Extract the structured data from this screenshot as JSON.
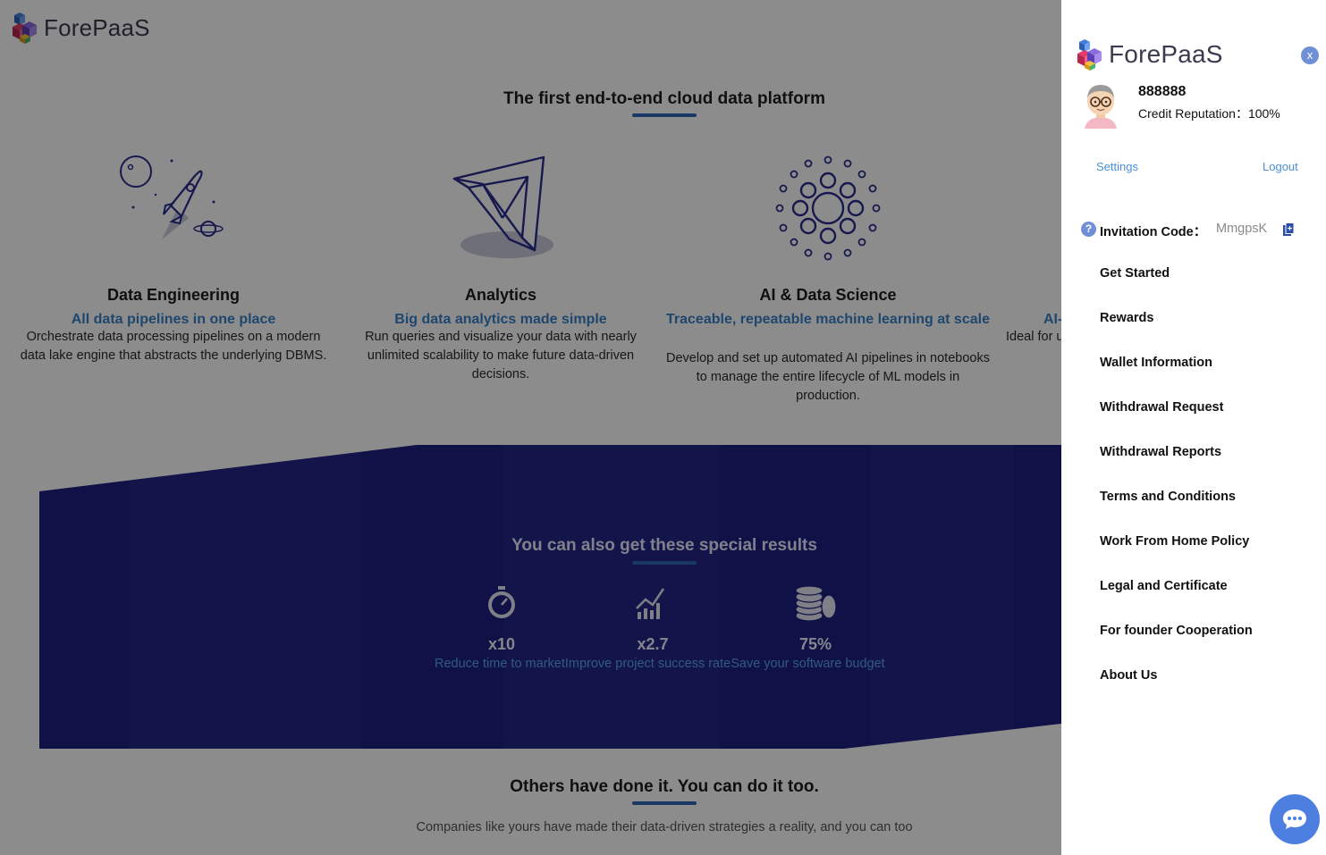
{
  "brand": {
    "name": "ForePaaS"
  },
  "hero": {
    "title": "The first end-to-end cloud data platform"
  },
  "features": [
    {
      "name": "Data Engineering",
      "tagline": "All data pipelines in one place",
      "description": "Orchestrate data processing pipelines on a modern data lake engine that abstracts the underlying DBMS."
    },
    {
      "name": "Analytics",
      "tagline": "Big data analytics made simple",
      "description": "Run queries and visualize your data with nearly unlimited scalability to make future data-driven decisions."
    },
    {
      "name": "AI & Data Science",
      "tagline": "Traceable, repeatable machine learning at scale",
      "description": "Develop and set up automated AI pipelines in notebooks to manage the entire lifecycle of ML models in production."
    },
    {
      "name": "",
      "tagline": "AI-",
      "description": "Ideal for u"
    }
  ],
  "results": {
    "title": "You can also get these special results",
    "stats": [
      {
        "value": "x10",
        "icon": "stopwatch-icon"
      },
      {
        "value": "x2.7",
        "icon": "growth-chart-icon"
      },
      {
        "value": "75%",
        "icon": "coins-icon"
      }
    ],
    "captions": "Reduce time to marketImprove project success rateSave your software budget"
  },
  "others": {
    "title": "Others have done it. You can do it too.",
    "subtitle": "Companies like yours have made their data-driven strategies a reality, and you can too"
  },
  "drawer": {
    "close_label": "x",
    "username": "888888",
    "credit": "Credit Reputation：100%",
    "settings": "Settings",
    "logout": "Logout",
    "invitation_label": "Invitation Code：",
    "invitation_code": "MmgpsK",
    "menu": [
      "Get Started",
      "Rewards",
      "Wallet Information",
      "Withdrawal Request",
      "Withdrawal Reports",
      "Terms and Conditions",
      "Work From Home Policy",
      "Legal and Certificate",
      "For founder Cooperation",
      "About Us"
    ]
  },
  "colors": {
    "accent": "#2e66b8",
    "band": "#1d1f82",
    "link": "#4a8fd8",
    "chat": "#4d7fe0"
  }
}
